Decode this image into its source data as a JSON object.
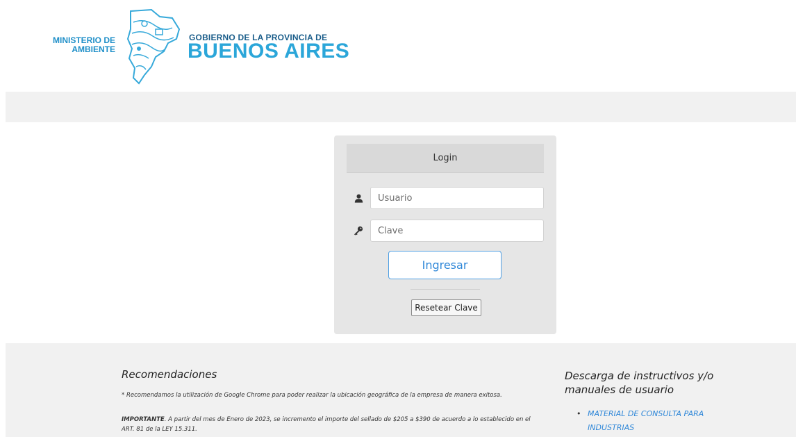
{
  "header": {
    "ministerio_line1": "MINISTERIO DE",
    "ministerio_line2": "AMBIENTE",
    "gobierno": "GOBIERNO DE LA PROVINCIA DE",
    "provincia": "BUENOS AIRES"
  },
  "login": {
    "title": "Login",
    "user_placeholder": "Usuario",
    "user_value": "",
    "user_icon": "user-icon",
    "password_placeholder": "Clave",
    "password_value": "",
    "password_icon": "key-icon",
    "submit_label": "Ingresar",
    "reset_label": "Resetear Clave"
  },
  "recommendations": {
    "title": "Recomendaciones",
    "note": "* Recomendamos la utilización de Google Chrome para poder realizar la ubicación geográfica de la empresa de manera exitosa.",
    "important_label": "IMPORTANTE",
    "important_text": ". A partir del mes de Enero de 2023, se incremento el importe del sellado de $205 a $390 de acuerdo a lo establecido en el ART. 81 de la LEY 15.311."
  },
  "downloads": {
    "title": "Descarga de instructivos y/o manuales de usuario",
    "items": [
      {
        "label": "MATERIAL DE CONSULTA PARA INDUSTRIAS"
      }
    ]
  },
  "colors": {
    "brand_blue": "#2ba6d9",
    "link_blue": "#2f87d8",
    "band_gray": "#f1f1f1",
    "card_gray": "#e6e6e6"
  }
}
